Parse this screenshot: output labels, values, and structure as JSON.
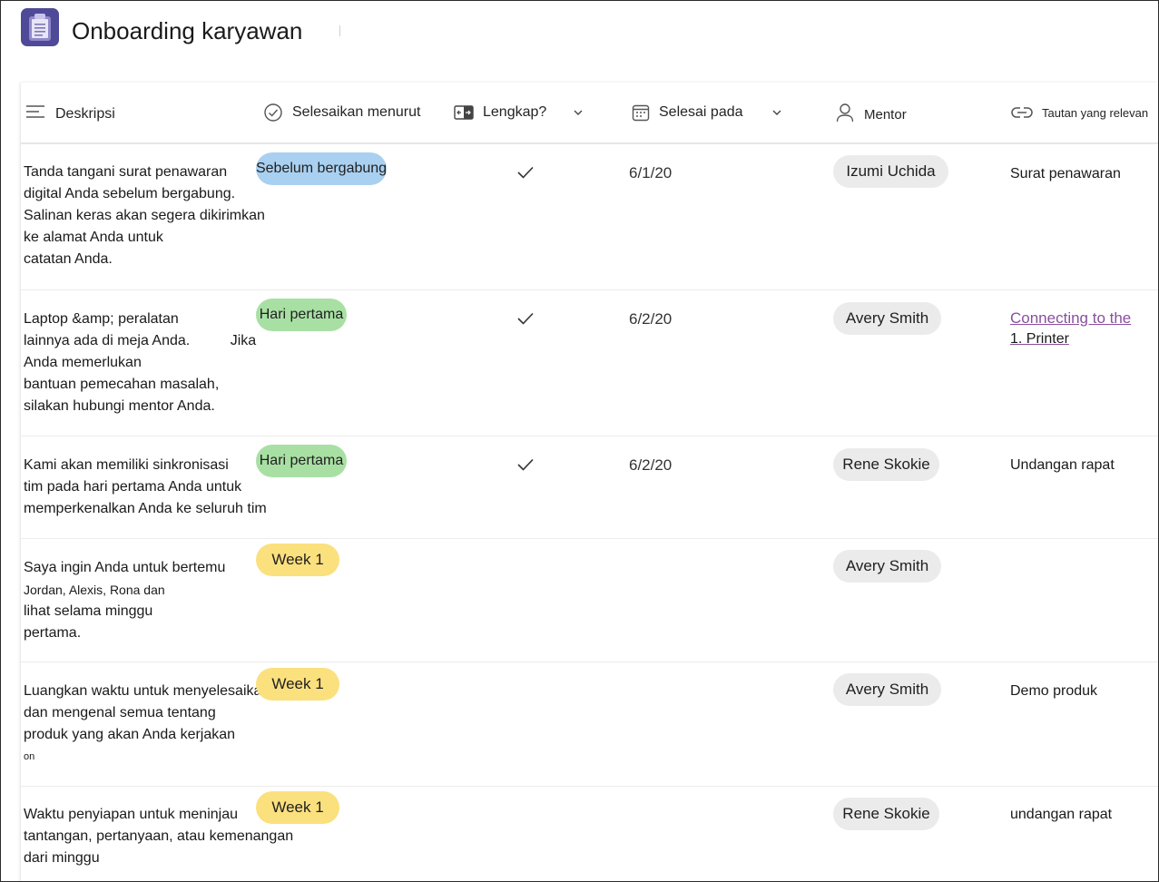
{
  "app": {
    "title": "Onboarding karyawan",
    "icon": "clipboard-icon",
    "accent": "#4f4a97"
  },
  "columns": [
    {
      "key": "description",
      "label": "Deskripsi",
      "icon": "lines-icon"
    },
    {
      "key": "due_by",
      "label": "Selesaikan menurut",
      "icon": "check-circle-icon"
    },
    {
      "key": "complete",
      "label": "Lengkap?",
      "icon": "toggle-icon"
    },
    {
      "key": "completed_on",
      "label": "Selesai pada",
      "icon": "calendar-icon"
    },
    {
      "key": "mentor",
      "label": "Mentor",
      "icon": "person-icon"
    },
    {
      "key": "links",
      "label": "Tautan yang relevan",
      "icon": "link-icon"
    }
  ],
  "rows": [
    {
      "description": [
        "Tanda tangani surat penawaran",
        "digital Anda sebelum bergabung.",
        "Salinan keras akan segera dikirimkan",
        "ke alamat Anda untuk",
        "catatan Anda."
      ],
      "due_by": "Sebelum bergabung",
      "due_color": "#a9d0f0",
      "complete": true,
      "completed_on": "6/1/20",
      "mentor": "Izumi Uchida",
      "link": "Surat penawaran"
    },
    {
      "description": [
        "Laptop &amp; peralatan",
        "lainnya ada di meja Anda.          Jika",
        "Anda memerlukan",
        "bantuan pemecahan masalah,",
        "silakan hubungi mentor Anda."
      ],
      "due_by": "Hari pertama",
      "due_color": "#a8e0a3",
      "complete": true,
      "completed_on": "6/2/20",
      "mentor": "Avery Smith",
      "link": "Connecting to the",
      "link_sub": "1. Printer",
      "link_color": "#8a4f9e"
    },
    {
      "description": [
        "Kami akan memiliki sinkronisasi",
        "tim pada hari pertama Anda untuk",
        "memperkenalkan Anda ke seluruh tim"
      ],
      "due_by": "Hari pertama",
      "due_color": "#a8e0a3",
      "complete": true,
      "completed_on": "6/2/20",
      "mentor": "Rene Skokie",
      "link": "Undangan rapat"
    },
    {
      "description": [
        "Saya ingin Anda untuk bertemu",
        "Jordan, Alexis, Rona dan",
        "lihat selama minggu",
        "pertama."
      ],
      "due_by": "Week 1",
      "due_color": "#fbe07e",
      "complete": false,
      "completed_on": "",
      "mentor": "Avery Smith",
      "link": ""
    },
    {
      "description": [
        "Luangkan waktu untuk menyelesaikan",
        "dan mengenal semua tentang",
        "produk yang akan Anda kerjakan",
        "on"
      ],
      "due_by": "Week 1",
      "due_color": "#fbe07e",
      "complete": false,
      "completed_on": "",
      "mentor": "Avery Smith",
      "link": "Demo produk"
    },
    {
      "description": [
        "Waktu penyiapan untuk meninjau",
        "tantangan, pertanyaan, atau kemenangan",
        "dari minggu"
      ],
      "due_by": "Week 1",
      "due_color": "#fbe07e",
      "complete": false,
      "completed_on": "",
      "mentor": "Rene Skokie",
      "link": "undangan rapat"
    }
  ]
}
